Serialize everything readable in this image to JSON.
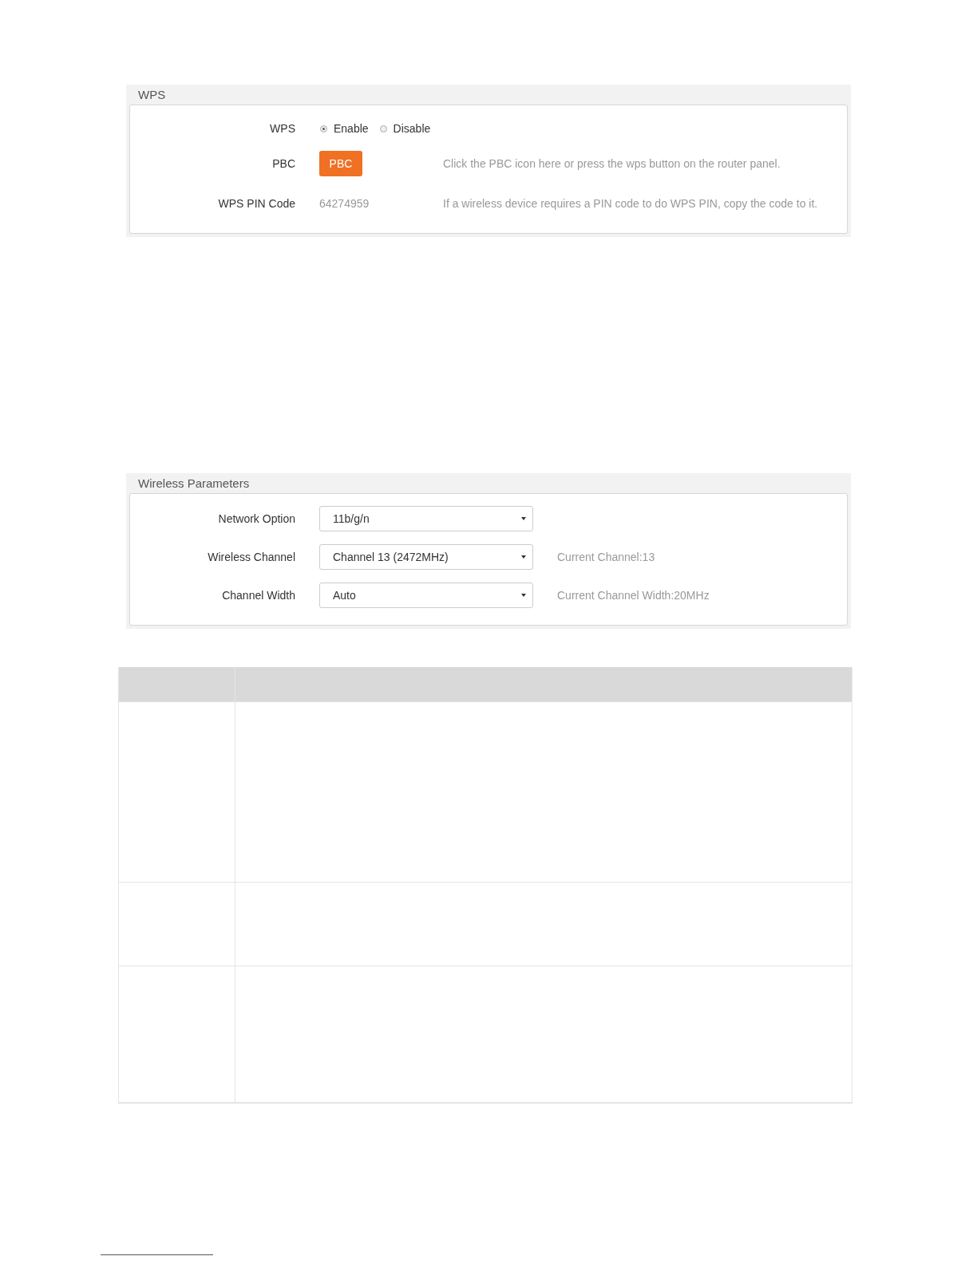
{
  "wps_panel": {
    "title": "WPS",
    "rows": [
      {
        "kind": "radio",
        "label": "WPS",
        "options": [
          {
            "label": "Enable",
            "selected": true
          },
          {
            "label": "Disable",
            "selected": false
          }
        ]
      },
      {
        "kind": "button",
        "label": "PBC",
        "button": "PBC",
        "description": "Click the PBC icon here or press the wps button on the router panel."
      },
      {
        "kind": "text",
        "label": "WPS PIN Code",
        "value": "64274959",
        "description": "If a wireless device requires a PIN code to do WPS PIN, copy the code to it."
      }
    ]
  },
  "wireless_panel": {
    "title": "Wireless Parameters",
    "rows": [
      {
        "label": "Network Option",
        "value": "11b/g/n"
      },
      {
        "label": "Wireless Channel",
        "value": "Channel 13 (2472MHz)",
        "note": "Current Channel:13"
      },
      {
        "label": "Channel Width",
        "value": "Auto",
        "note": "Current Channel Width:20MHz"
      }
    ]
  }
}
